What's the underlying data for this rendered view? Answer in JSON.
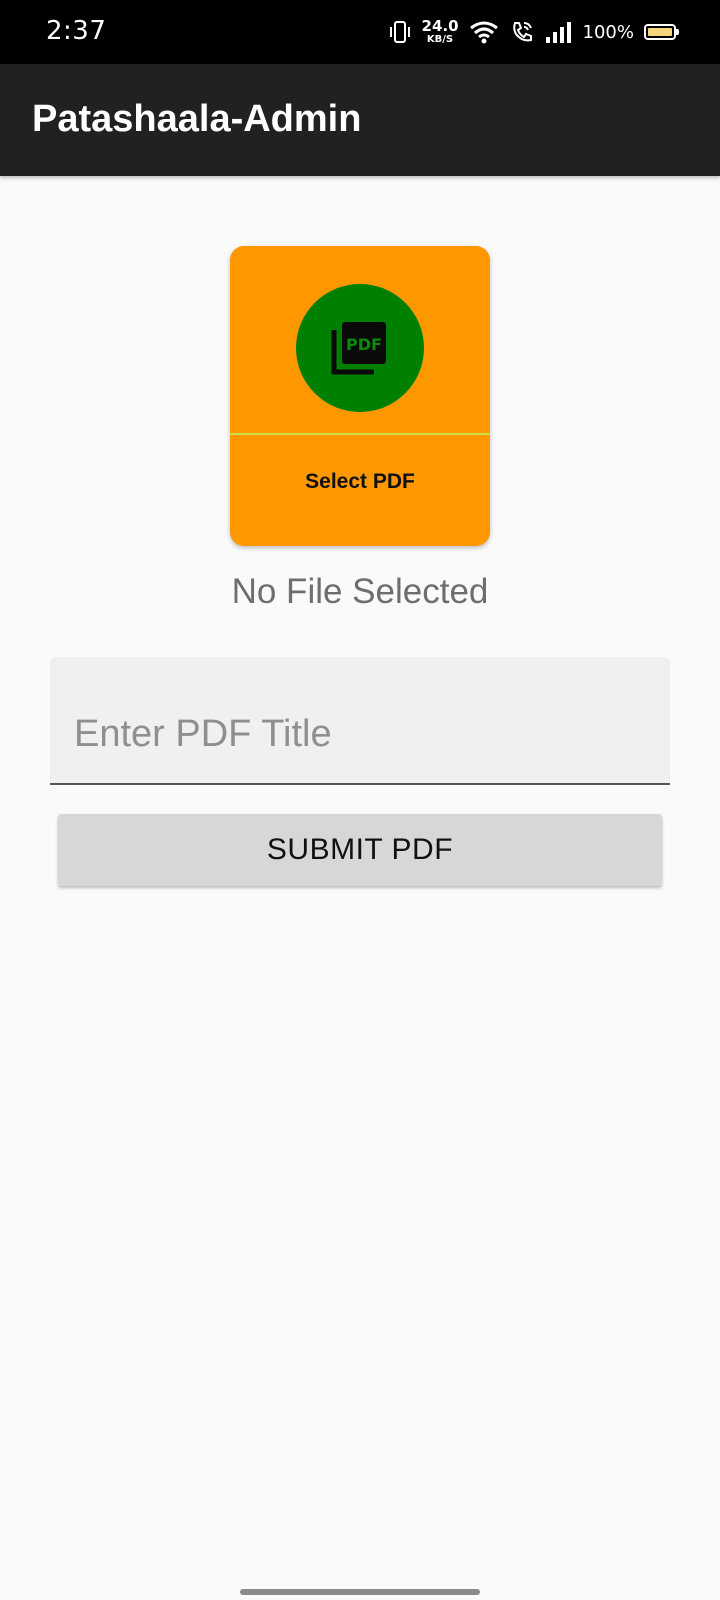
{
  "status_bar": {
    "time": "2:37",
    "net_speed_value": "24.0",
    "net_speed_unit": "KB/S",
    "battery_percent": "100%",
    "icons": [
      "vibrate-icon",
      "wifi-icon",
      "wifi-call-icon",
      "signal-icon",
      "battery-icon"
    ]
  },
  "app_bar": {
    "title": "Patashaala-Admin",
    "background_color": "#212121"
  },
  "select_card": {
    "label": "Select PDF",
    "icon": "pdf-icon",
    "card_color": "#ff9800",
    "circle_color": "#008000"
  },
  "file_status": "No File Selected",
  "title_input": {
    "placeholder": "Enter PDF Title",
    "value": ""
  },
  "submit_button": {
    "label": "SUBMIT PDF"
  }
}
